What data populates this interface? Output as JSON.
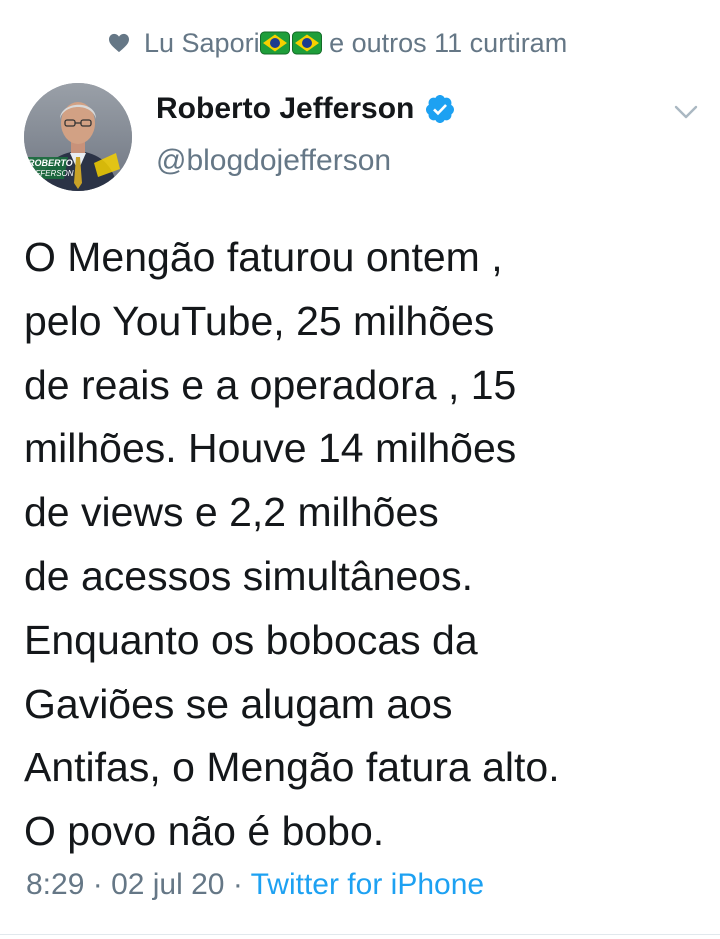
{
  "context": {
    "icon": "heart-icon",
    "liker_name": "Lu Sapori",
    "liker_flags": [
      "brazil-flag",
      "brazil-flag"
    ],
    "suffix": " e outros 11 curtiram"
  },
  "author": {
    "name": "Roberto Jefferson",
    "handle": "@blogdojefferson",
    "verified": true,
    "avatar_caption_line1": "ROBERTO",
    "avatar_caption_line2": "JEFFERSON"
  },
  "tweet": {
    "lines": [
      "O Mengão faturou ontem ,",
      "pelo YouTube, 25 milhões",
      "de reais e a operadora , 15",
      "milhões. Houve 14 milhões",
      "de views e 2,2 milhões",
      "de acessos simultâneos.",
      "Enquanto os bobocas da",
      "Gaviões se alugam aos",
      "Antifas, o Mengão fatura alto.",
      "O povo não é bobo."
    ]
  },
  "meta": {
    "time": "8:29",
    "separator": " · ",
    "date": "02 jul 20",
    "source": "Twitter for iPhone"
  },
  "colors": {
    "text": "#14171a",
    "secondary": "#657786",
    "link": "#1da1f2",
    "verified": "#1da1f2"
  }
}
